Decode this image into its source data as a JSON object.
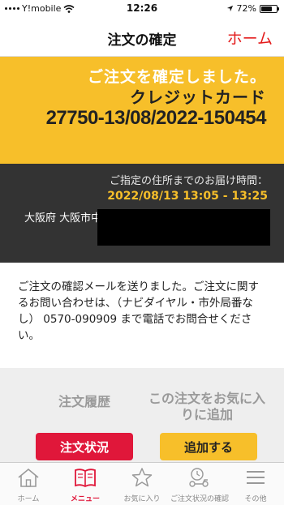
{
  "status_bar": {
    "carrier": "Y!mobile",
    "time": "12:26",
    "battery": "72%",
    "battery_level": 0.72
  },
  "nav": {
    "title": "注文の確定",
    "home_label": "ホーム"
  },
  "banner": {
    "confirmed": "ご注文を確定しました。",
    "payment": "クレジットカード",
    "order_number": "27750-13/08/2022-150454"
  },
  "delivery": {
    "heading": "ご指定の住所までのお届け時間：",
    "time": "2022/08/13 13:05 - 13:25",
    "address": "大阪府 大阪市中央区"
  },
  "message": {
    "text": "ご注文の確認メールを送りました。ご注文に関するお問い合わせは、（ナビダイヤル・市外局番なし） 0570-090909 まで電話でお問合せください。"
  },
  "actions": {
    "history_label": "注文履歴",
    "favorite_label": "この注文をお気に入りに追加",
    "status_button": "注文状況",
    "add_button": "追加する"
  },
  "tabs": [
    {
      "label": "ホーム",
      "icon": "house-icon"
    },
    {
      "label": "メニュー",
      "icon": "menu-book-icon"
    },
    {
      "label": "お気に入り",
      "icon": "star-icon"
    },
    {
      "label": "ご注文状況の確認",
      "icon": "delivery-scooter-icon"
    },
    {
      "label": "その他",
      "icon": "hamburger-icon"
    }
  ],
  "colors": {
    "accent_red": "#e0173a",
    "accent_yellow": "#f7bf2a",
    "dark": "#333333"
  }
}
